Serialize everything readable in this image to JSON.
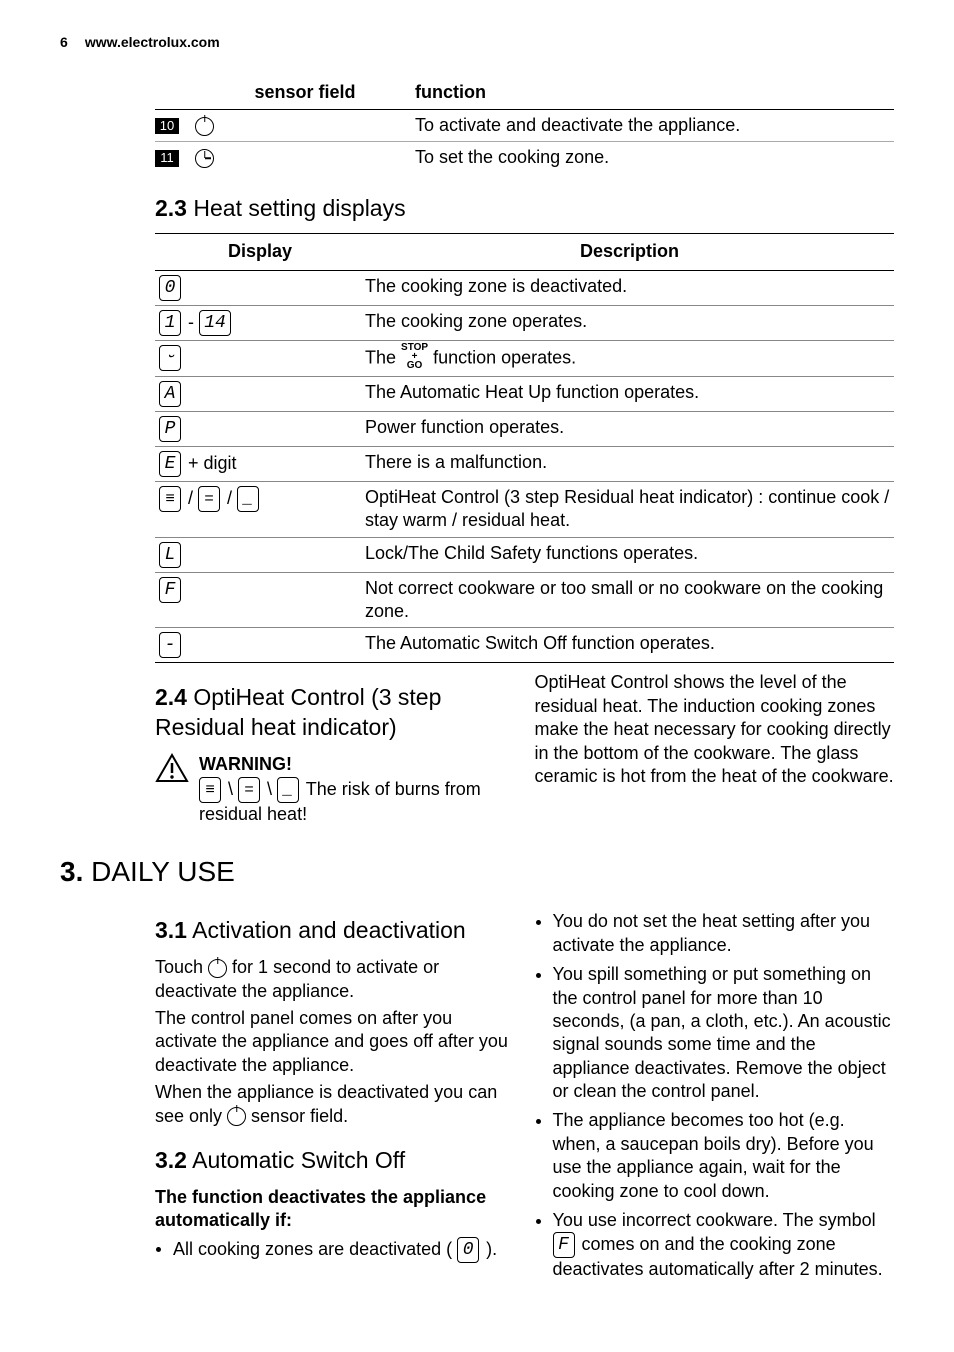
{
  "header": {
    "page_num": "6",
    "url": "www.electrolux.com"
  },
  "fn_table": {
    "col1": "sensor field",
    "col2": "function",
    "rows": [
      {
        "badge": "10",
        "desc": "To activate and deactivate the appliance."
      },
      {
        "badge": "11",
        "desc": "To set the cooking zone."
      }
    ]
  },
  "sec23": {
    "num": "2.3",
    "title": "Heat setting displays"
  },
  "disp_table": {
    "col1": "Display",
    "col2": "Description",
    "rows": {
      "r0": {
        "sym": "0",
        "desc": "The cooking zone is deactivated."
      },
      "r1": {
        "sym1": "1",
        "sep": " - ",
        "sym2": "14",
        "desc": "The cooking zone operates."
      },
      "r2": {
        "sym": "⏑",
        "desc_a": "The ",
        "desc_b": " function operates."
      },
      "r3": {
        "sym": "A",
        "desc": "The Automatic Heat Up function operates."
      },
      "r4": {
        "sym": "P",
        "desc": "Power function operates."
      },
      "r5": {
        "sym": "E",
        "extra": " + digit",
        "desc": "There is a malfunction."
      },
      "r6": {
        "s1": "⋮",
        "s2": "⠤",
        "s3": "_",
        "sep": " / ",
        "desc": "OptiHeat Control (3 step Residual heat indicator) : continue cook / stay warm / residual heat."
      },
      "r7": {
        "sym": "L",
        "desc": "Lock/The Child Safety functions operates."
      },
      "r8": {
        "sym": "F",
        "desc": "Not correct cookware or too small or no cookware on the cooking zone."
      },
      "r9": {
        "sym": "-",
        "desc": "The Automatic Switch Off function operates."
      }
    }
  },
  "sec24": {
    "num": "2.4",
    "title": "OptiHeat Control (3 step Residual heat indicator)",
    "warn_label": "WARNING!",
    "warn_text_pre_seg1": "",
    "warn_sep": " \\ ",
    "warn_text_after": " The risk of burns from residual heat!",
    "right_para": "OptiHeat Control shows the level of the residual heat. The induction cooking zones make the heat necessary for cooking directly in the bottom of the cookware. The glass ceramic is hot from the heat of the cookware."
  },
  "sec3": {
    "num": "3.",
    "title": "DAILY USE"
  },
  "sec31": {
    "num": "3.1",
    "title": "Activation and deactivation",
    "p1a": "Touch ",
    "p1b": " for 1 second to activate or deactivate the appliance.",
    "p2": "The control panel comes on after you activate the appliance and goes off after you deactivate the appliance.",
    "p3a": "When the appliance is deactivated you can see only ",
    "p3b": " sensor field."
  },
  "sec32": {
    "num": "3.2",
    "title": "Automatic Switch Off",
    "sub": "The function deactivates the appliance automatically if:",
    "b1a": "All cooking zones are deactivated ( ",
    "b1_sym": "0",
    "b1b": " )."
  },
  "right_bullets": {
    "b1": "You do not set the heat setting after you activate the appliance.",
    "b2": "You spill something or put something on the control panel for more than 10 seconds, (a pan, a cloth, etc.). An acoustic signal sounds some time and the appliance deactivates. Remove the object or clean the control panel.",
    "b3": "The appliance becomes too hot (e.g. when, a saucepan boils dry). Before you use the appliance again, wait for the cooking zone to cool down.",
    "b4a": "You use incorrect cookware. The symbol ",
    "b4_sym": "F",
    "b4b": " comes on and the cooking zone deactivates automatically after 2 minutes."
  },
  "stopgo": {
    "l1": "STOP",
    "l2": "+",
    "l3": "GO"
  }
}
